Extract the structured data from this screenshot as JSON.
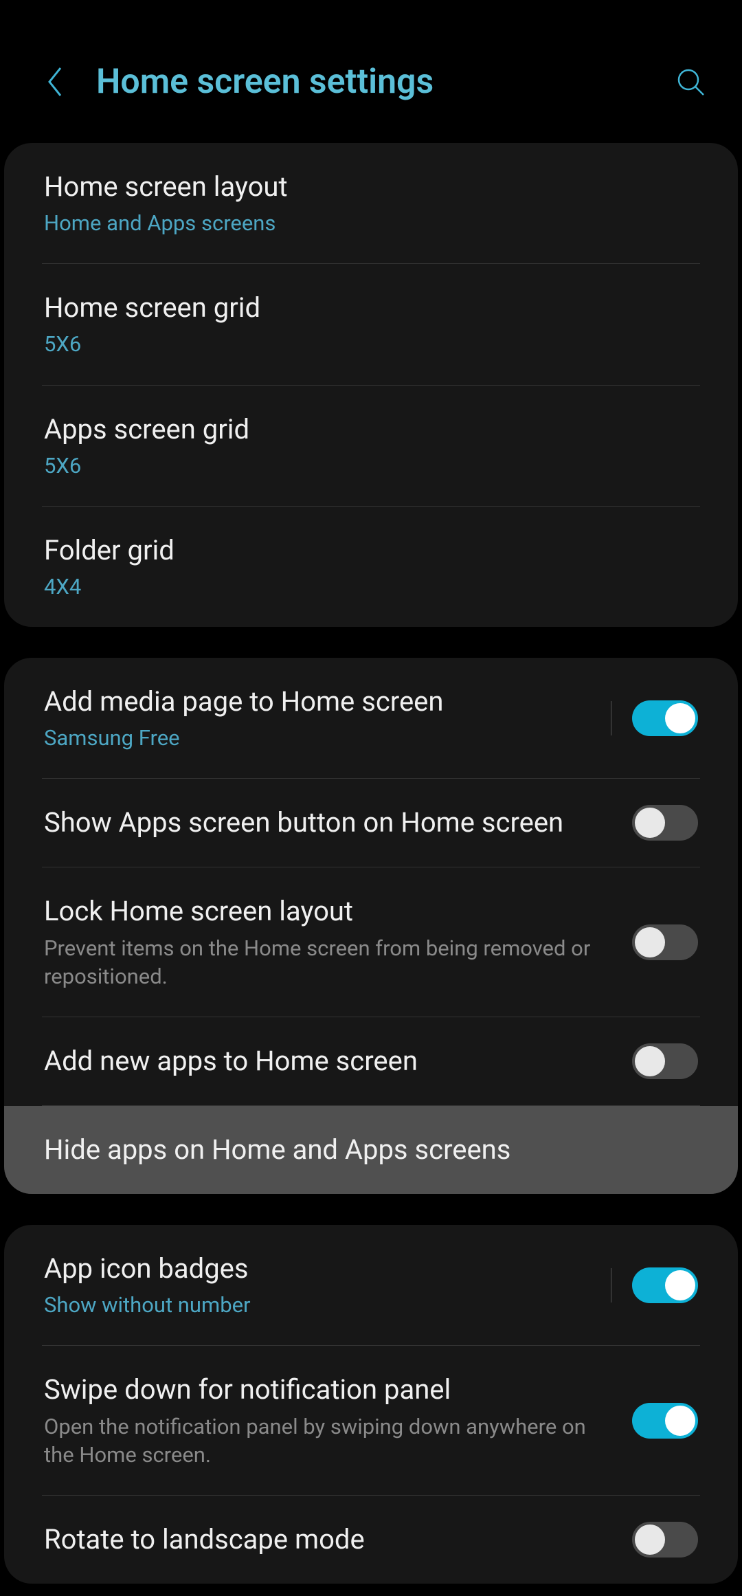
{
  "header": {
    "title": "Home screen settings"
  },
  "sections": [
    {
      "items": [
        {
          "title": "Home screen layout",
          "subtitle": "Home and Apps screens"
        },
        {
          "title": "Home screen grid",
          "subtitle": "5X6"
        },
        {
          "title": "Apps screen grid",
          "subtitle": "5X6"
        },
        {
          "title": "Folder grid",
          "subtitle": "4X4"
        }
      ]
    },
    {
      "items": [
        {
          "title": "Add media page to Home screen",
          "subtitle": "Samsung Free",
          "toggle": true,
          "has_vert_divider": true
        },
        {
          "title": "Show Apps screen button on Home screen",
          "toggle": false
        },
        {
          "title": "Lock Home screen layout",
          "description": "Prevent items on the Home screen from being removed or repositioned.",
          "toggle": false
        },
        {
          "title": "Add new apps to Home screen",
          "toggle": false
        },
        {
          "title": "Hide apps on Home and Apps screens",
          "highlighted": true
        }
      ]
    },
    {
      "items": [
        {
          "title": "App icon badges",
          "subtitle": "Show without number",
          "toggle": true,
          "has_vert_divider": true
        },
        {
          "title": "Swipe down for notification panel",
          "description": "Open the notification panel by swiping down anywhere on the Home screen.",
          "toggle": true
        },
        {
          "title": "Rotate to landscape mode",
          "toggle": false
        }
      ]
    }
  ]
}
